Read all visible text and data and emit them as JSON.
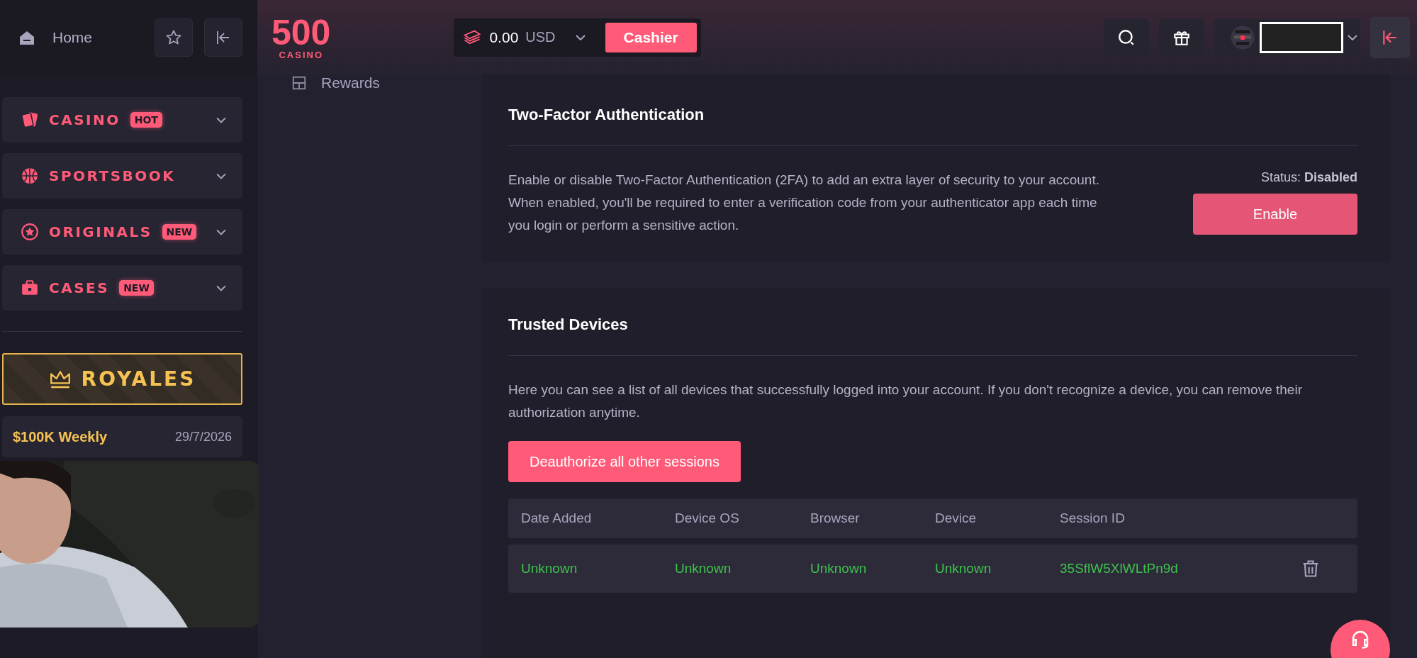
{
  "sidebar": {
    "home_label": "Home",
    "nav": [
      {
        "label": "CASINO",
        "badge": "HOT"
      },
      {
        "label": "SPORTSBOOK"
      },
      {
        "label": "ORIGINALS",
        "badge": "NEW"
      },
      {
        "label": "CASES",
        "badge": "NEW"
      }
    ],
    "promo": {
      "title": "ROYALES"
    },
    "event": {
      "title": "$100K Weekly",
      "date": "29/7/2026"
    }
  },
  "header": {
    "logo": {
      "number": "500",
      "word": "CASINO"
    },
    "wallet": {
      "amount": "0.00",
      "currency": "USD"
    },
    "cashier_button": "Cashier"
  },
  "secondary_nav": [
    {
      "label": "Rewards"
    }
  ],
  "two_factor": {
    "title": "Two-Factor Authentication",
    "description": "Enable or disable Two-Factor Authentication (2FA) to add an extra layer of security to your account. When enabled, you'll be required to enter a verification code from your authenticator app each time you login or perform a sensitive action.",
    "status_label": "Status:",
    "status_value": "Disabled",
    "button": "Enable"
  },
  "trusted_devices": {
    "title": "Trusted Devices",
    "description": "Here you can see a list of all devices that successfully logged into your account. If you don't recognize a device, you can remove their authorization anytime.",
    "button": "Deauthorize all other sessions",
    "columns": [
      "Date Added",
      "Device OS",
      "Browser",
      "Device",
      "Session ID"
    ],
    "rows": [
      {
        "cells": [
          "Unknown",
          "Unknown",
          "Unknown",
          "Unknown",
          "35SflW5XlWLtPn9d"
        ]
      }
    ]
  }
}
